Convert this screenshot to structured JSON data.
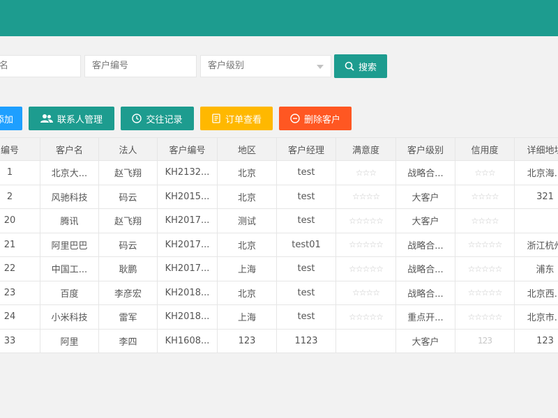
{
  "search": {
    "field1_value": "名",
    "field2_placeholder": "客户编号",
    "field3_placeholder": "客户级别",
    "search_label": "搜索"
  },
  "toolbar": {
    "add_label": "添加",
    "contacts_label": "联系人管理",
    "records_label": "交往记录",
    "orders_label": "订单查看",
    "delete_label": "删除客户"
  },
  "table": {
    "headers": [
      "编号",
      "客户名",
      "法人",
      "客户编号",
      "地区",
      "客户经理",
      "满意度",
      "客户级别",
      "信用度",
      "详细地址"
    ],
    "rows": [
      [
        "1",
        "北京大...",
        "赵飞翔",
        "KH2132...",
        "北京",
        "test",
        "☆☆☆",
        "战略合...",
        "☆☆☆",
        "北京海..."
      ],
      [
        "2",
        "风驰科技",
        "码云",
        "KH2015...",
        "北京",
        "test",
        "☆☆☆☆",
        "大客户",
        "☆☆☆☆",
        "321"
      ],
      [
        "20",
        "腾讯",
        "赵飞翔",
        "KH2017...",
        "测试",
        "test",
        "☆☆☆☆☆",
        "大客户",
        "☆☆☆☆",
        ""
      ],
      [
        "21",
        "阿里巴巴",
        "码云",
        "KH2017...",
        "北京",
        "test01",
        "☆☆☆☆☆",
        "战略合...",
        "☆☆☆☆☆",
        "浙江杭州"
      ],
      [
        "22",
        "中国工...",
        "耿鹏",
        "KH2017...",
        "上海",
        "test",
        "☆☆☆☆☆",
        "战略合...",
        "☆☆☆☆☆",
        "浦东"
      ],
      [
        "23",
        "百度",
        "李彦宏",
        "KH2018...",
        "北京",
        "test",
        "☆☆☆☆",
        "战略合...",
        "☆☆☆☆☆",
        "北京西..."
      ],
      [
        "24",
        "小米科技",
        "雷军",
        "KH2018...",
        "上海",
        "test",
        "☆☆☆☆☆",
        "重点开...",
        "☆☆☆☆☆",
        "北京市..."
      ],
      [
        "33",
        "阿里",
        "李四",
        "KH1608...",
        "123",
        "1123",
        "",
        "大客户",
        "123",
        "123"
      ]
    ]
  },
  "colors": {
    "primary": "#1d9c8f",
    "blue": "#1e9fff",
    "warn": "#ffb800",
    "danger": "#ff5722"
  }
}
